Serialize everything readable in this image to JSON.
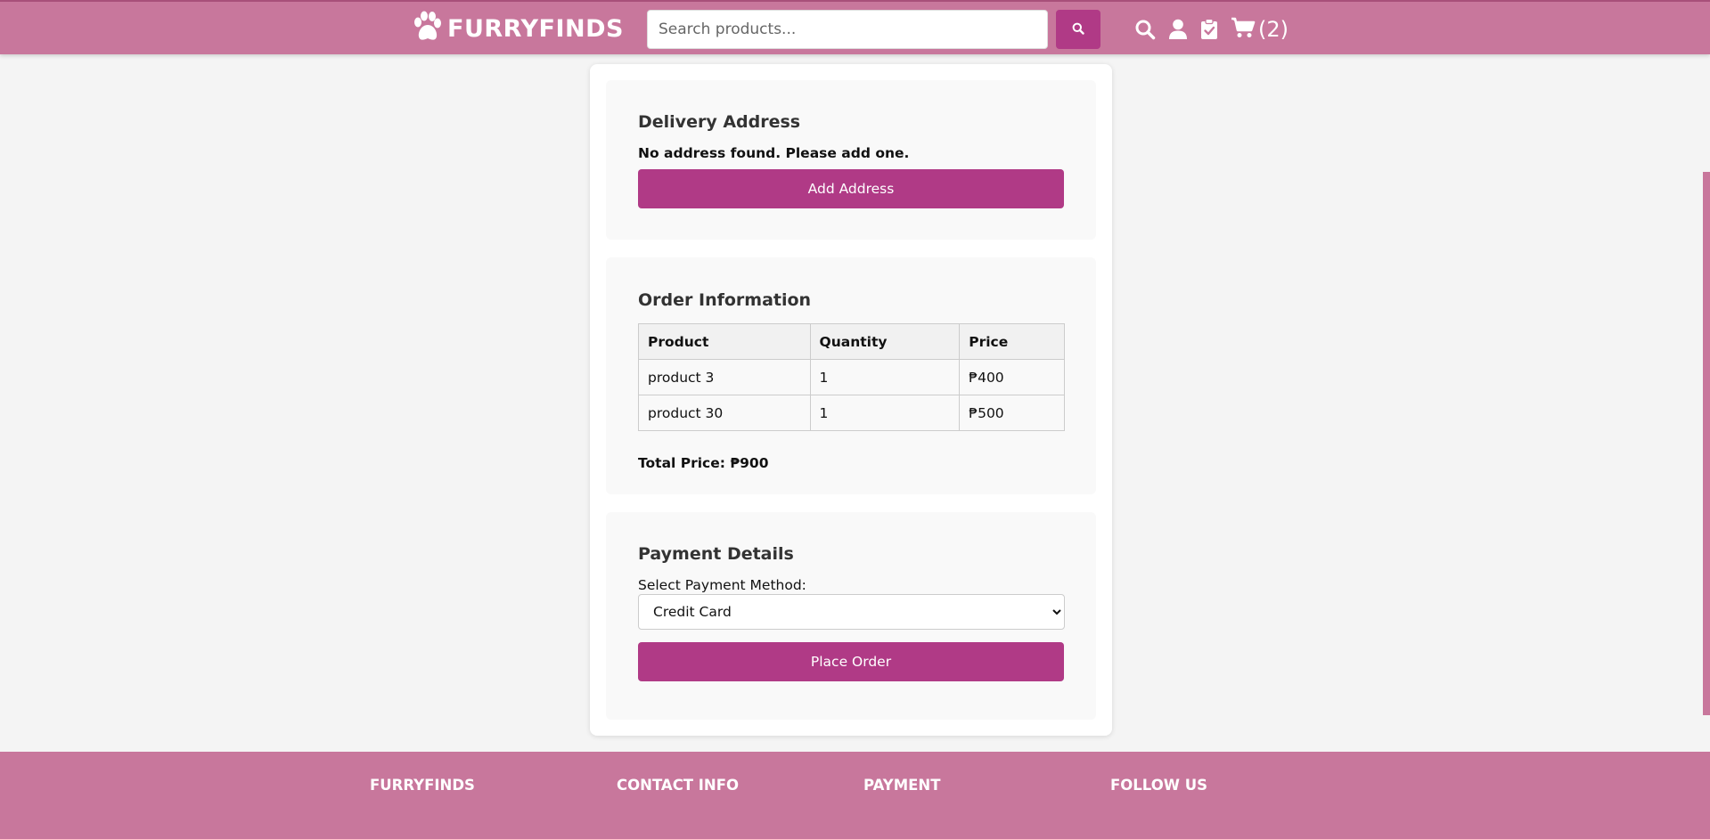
{
  "header": {
    "logo_text": "FURRYFINDS",
    "search_placeholder": "Search products...",
    "search_button_icon": "search-icon",
    "nav_icons": [
      "search-icon",
      "user-icon",
      "clipboard-check-icon",
      "cart-icon"
    ],
    "cart_count": "(2)",
    "accent_color": "#c8779c"
  },
  "delivery": {
    "title": "Delivery Address",
    "message": "No address found. Please add one.",
    "add_button": "Add Address"
  },
  "order": {
    "title": "Order Information",
    "columns": [
      "Product",
      "Quantity",
      "Price"
    ],
    "rows": [
      {
        "product": "product 3",
        "quantity": "1",
        "price": "₱400"
      },
      {
        "product": "product 30",
        "quantity": "1",
        "price": "₱500"
      }
    ],
    "total": "Total Price: ₱900"
  },
  "payment": {
    "title": "Payment Details",
    "label": "Select Payment Method:",
    "selected": "Credit Card",
    "place_button": "Place Order",
    "button_color": "#b03a86"
  },
  "footer": {
    "columns": [
      "FURRYFINDS",
      "CONTACT INFO",
      "PAYMENT",
      "FOLLOW US"
    ]
  }
}
